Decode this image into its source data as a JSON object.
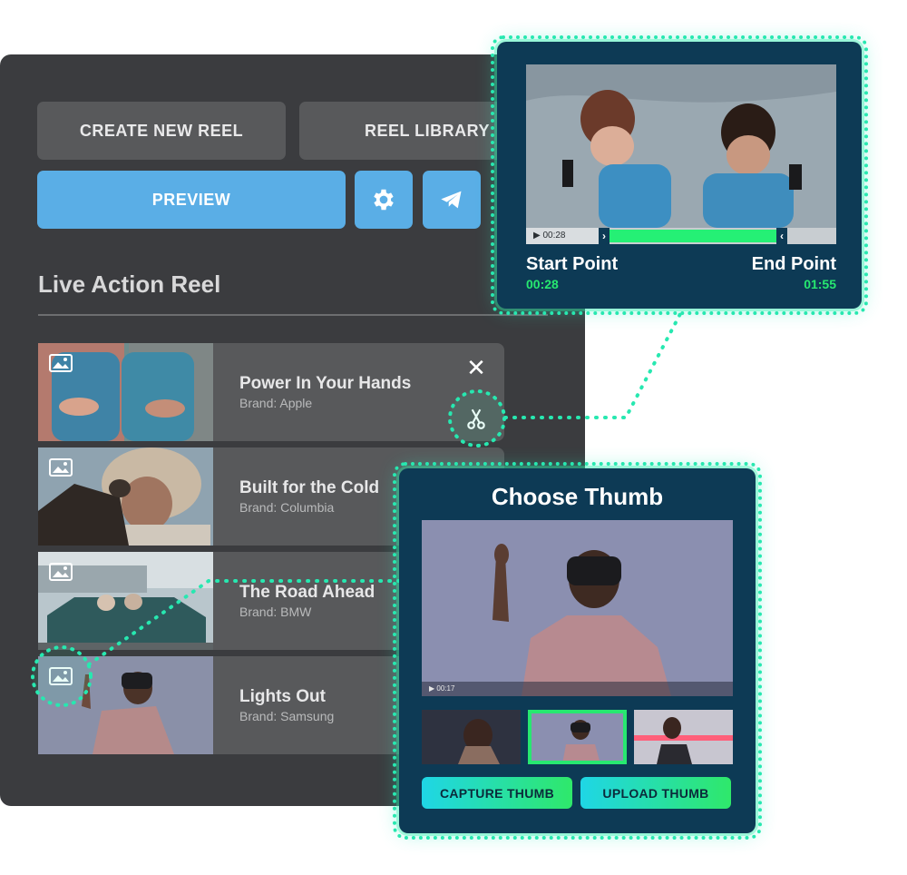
{
  "toolbar": {
    "create_label": "CREATE NEW REEL",
    "library_label": "REEL LIBRARY",
    "preview_label": "PREVIEW"
  },
  "reel": {
    "title": "Live Action Reel",
    "items": [
      {
        "name": "Power In Your Hands",
        "brand": "Brand: Apple"
      },
      {
        "name": "Built for the Cold",
        "brand": "Brand: Columbia"
      },
      {
        "name": "The Road Ahead",
        "brand": "Brand: BMW"
      },
      {
        "name": "Lights Out",
        "brand": "Brand: Samsung"
      }
    ]
  },
  "trim": {
    "current_time": "▶ 00:28",
    "start_label": "Start Point",
    "start_value": "00:28",
    "end_label": "End Point",
    "end_value": "01:55"
  },
  "thumb": {
    "title": "Choose Thumb",
    "video_time": "▶ 00:17",
    "capture_label": "CAPTURE THUMB",
    "upload_label": "UPLOAD THUMB"
  },
  "colors": {
    "panel": "#3b3c3f",
    "button_grey": "#58595b",
    "accent_blue": "#5aaee6",
    "callout_bg": "#0d3a55",
    "highlight_green": "#27e870",
    "glow_teal": "#27e8b0"
  }
}
